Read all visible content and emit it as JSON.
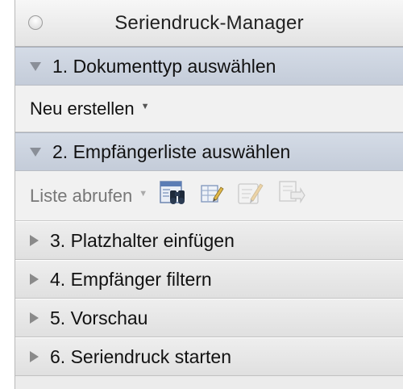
{
  "window": {
    "title": "Seriendruck-Manager"
  },
  "sections": [
    {
      "label": "1. Dokumenttyp auswählen",
      "expanded": true
    },
    {
      "label": "2. Empfängerliste auswählen",
      "expanded": true
    },
    {
      "label": "3. Platzhalter einfügen",
      "expanded": false
    },
    {
      "label": "4. Empfänger filtern",
      "expanded": false
    },
    {
      "label": "5. Vorschau",
      "expanded": false
    },
    {
      "label": "6. Seriendruck starten",
      "expanded": false
    }
  ],
  "document_type": {
    "dropdown_label": "Neu erstellen"
  },
  "recipient_list": {
    "dropdown_label": "Liste abrufen",
    "tools": [
      {
        "icon": "find-contacts-icon",
        "enabled": true
      },
      {
        "icon": "edit-list-icon",
        "enabled": true
      },
      {
        "icon": "edit-source-icon",
        "enabled": false
      },
      {
        "icon": "import-list-icon",
        "enabled": false
      }
    ]
  },
  "colors": {
    "open_header": "#c8d0dc",
    "closed_header": "#e6e6e6",
    "panel_background": "#ececec"
  }
}
